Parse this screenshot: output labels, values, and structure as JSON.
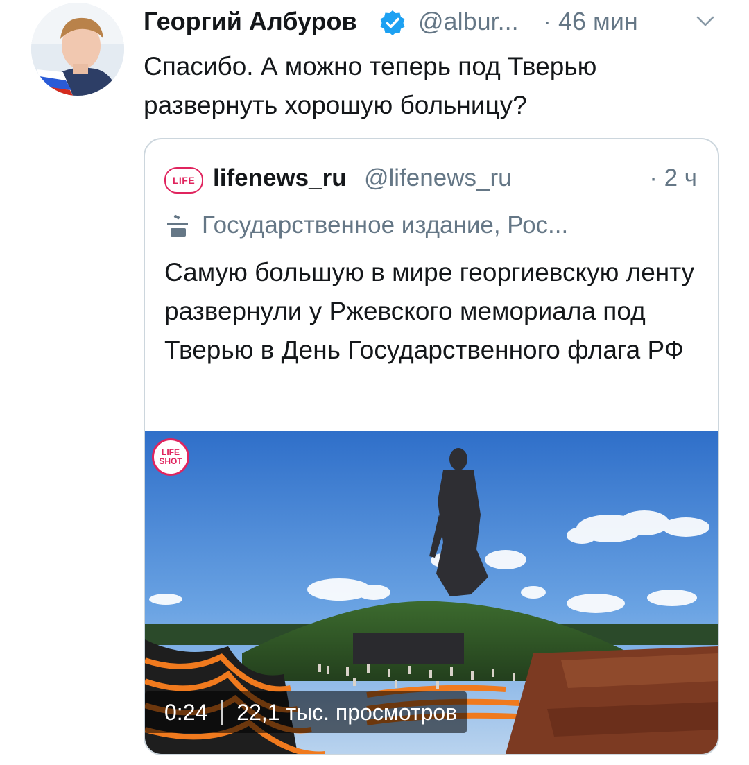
{
  "tweet": {
    "author_name": "Георгий Албуров",
    "handle": "@albur...",
    "separator": "·",
    "time": "46 мин",
    "text": "Спасибо. А можно теперь под Тверью развернуть хорошую больницу?",
    "avatar_icon": "user-avatar-photo",
    "verified_icon": "verified-badge-icon",
    "menu_icon": "chevron-down-icon"
  },
  "quoted": {
    "logo_text": "LIFE",
    "name": "lifenews_ru",
    "handle": "@lifenews_ru",
    "time": "· 2 ч",
    "label_icon": "podium-icon",
    "label": "Государственное издание, Рос...",
    "text": "Самую большую в мире георгиевскую ленту развернули у Ржевского мемориала под Тверью в День Государственного флага РФ",
    "media": {
      "watermark_line1": "LIFE",
      "watermark_line2": "SHOT",
      "duration": "0:24",
      "views": "22,1 тыс. просмотров"
    }
  },
  "colors": {
    "text": "#14171a",
    "secondary": "#657786",
    "verified": "#1da1f2",
    "border": "#ccd6dd",
    "life_red": "#e0245e"
  }
}
